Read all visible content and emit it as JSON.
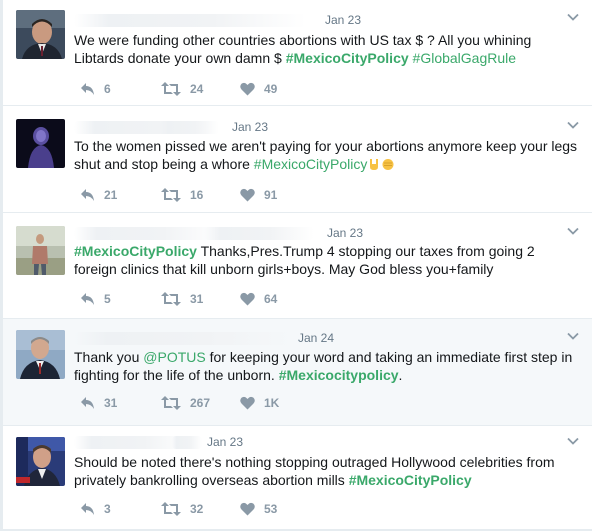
{
  "colors": {
    "hashtag": "#3aa86a",
    "icon": "#8a99a6",
    "text": "#14171a",
    "date": "#657786"
  },
  "tweets": [
    {
      "date": "Jan 23",
      "avatar_icon": "man-in-suit-avatar",
      "segments": [
        {
          "t": "text",
          "v": "We were funding other countries abortions with US tax $ ? All you whining Libtards donate your own damn $  "
        },
        {
          "t": "hashtag-bold",
          "v": "#MexicoCityPolicy"
        },
        {
          "t": "text",
          "v": " "
        },
        {
          "t": "hashtag",
          "v": "#GlobalGagRule"
        }
      ],
      "replies": "6",
      "retweets": "24",
      "likes": "49"
    },
    {
      "date": "Jan 23",
      "avatar_icon": "dark-figure-avatar",
      "segments": [
        {
          "t": "text",
          "v": "To the women pissed we aren't paying for your abortions anymore keep your legs shut  and stop being a whore "
        },
        {
          "t": "hashtag",
          "v": "#MexicoCityPolicy"
        }
      ],
      "emojis": [
        "horns-hand-emoji",
        "fist-emoji"
      ],
      "replies": "21",
      "retweets": "16",
      "likes": "91"
    },
    {
      "date": "Jan 23",
      "avatar_icon": "man-outdoors-avatar",
      "segments": [
        {
          "t": "hashtag-bold",
          "v": "#MexicoCityPolicy"
        },
        {
          "t": "text",
          "v": " Thanks,Pres.Trump 4 stopping our taxes from going 2 foreign clinics that kill unborn girls+boys.  May God bless you+family"
        }
      ],
      "replies": "5",
      "retweets": "31",
      "likes": "64"
    },
    {
      "date": "Jan 24",
      "avatar_icon": "official-portrait-avatar",
      "segments": [
        {
          "t": "text",
          "v": "Thank you "
        },
        {
          "t": "mention",
          "v": "@POTUS"
        },
        {
          "t": "text",
          "v": " for keeping your word and taking an immediate first step in fighting for the life of the unborn. "
        },
        {
          "t": "hashtag-bold",
          "v": "#Mexicocitypolicy"
        },
        {
          "t": "text",
          "v": "."
        }
      ],
      "replies": "31",
      "retweets": "267",
      "likes": "1K"
    },
    {
      "date": "Jan 23",
      "avatar_icon": "tv-host-avatar",
      "segments": [
        {
          "t": "text",
          "v": "Should be noted there's nothing stopping outraged Hollywood celebrities from privately bankrolling overseas abortion mills "
        },
        {
          "t": "hashtag-bold",
          "v": "#MexicoCityPolicy"
        }
      ],
      "replies": "3",
      "retweets": "32",
      "likes": "53"
    }
  ]
}
